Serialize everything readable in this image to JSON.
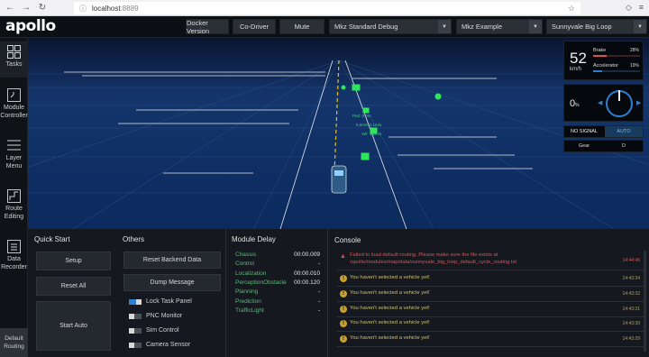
{
  "browser": {
    "url_host": "localhost",
    "url_port": ":8889"
  },
  "app": {
    "logo": "apollo"
  },
  "topbar": {
    "docker_version": "Docker Version",
    "co_driver": "Co-Driver",
    "mute": "Mute",
    "mode_select": "Mkz Standard Debug",
    "vehicle_select": "Mkz Example",
    "map_select": "Sunnyvale Big Loop"
  },
  "sidebar": {
    "items": [
      {
        "label": "Tasks",
        "icon": "tasks-grid-icon"
      },
      {
        "label": "Module Controller",
        "icon": "module-controller-icon"
      },
      {
        "label": "Layer Menu",
        "icon": "layer-menu-icon"
      },
      {
        "label": "Route Editing",
        "icon": "route-editing-icon"
      },
      {
        "label": "Data Recorder",
        "icon": "data-recorder-icon"
      }
    ],
    "default_routing": "Default Routing"
  },
  "status": {
    "speed": "52",
    "speed_unit": "km/h",
    "brake_label": "Brake",
    "brake_value": "28%",
    "accel_label": "Accelerator",
    "accel_value": "19%",
    "brake_fraction": 0.28,
    "accel_fraction": 0.19,
    "steering_value": "0",
    "steering_unit": "%",
    "signal": "NO SIGNAL",
    "drive_mode": "AUTO",
    "gear_label": "Gear",
    "gear_value": "D"
  },
  "scene": {
    "obstacle_labels": [
      "Ped: 0.0m",
      "0.0m/s 4.1m/s",
      "Vel: 1.2m/s"
    ]
  },
  "quick_start": {
    "title": "Quick Start",
    "setup": "Setup",
    "reset_all": "Reset All",
    "start_auto": "Start Auto"
  },
  "others": {
    "title": "Others",
    "reset_backend": "Reset Backend Data",
    "dump_message": "Dump Message",
    "toggles": [
      {
        "label": "Lock Task Panel",
        "on": true
      },
      {
        "label": "PNC Monitor",
        "on": false
      },
      {
        "label": "Sim Control",
        "on": false
      },
      {
        "label": "Camera Sensor",
        "on": false
      }
    ]
  },
  "module_delay": {
    "title": "Module Delay",
    "rows": [
      {
        "name": "Chassis",
        "value": "00:00.009"
      },
      {
        "name": "Control",
        "value": "-"
      },
      {
        "name": "Localization",
        "value": "00:00.010"
      },
      {
        "name": "PerceptionObstacle",
        "value": "00:00.120"
      },
      {
        "name": "Planning",
        "value": "-"
      },
      {
        "name": "Prediction",
        "value": "-"
      },
      {
        "name": "TrafficLight",
        "value": "-"
      }
    ]
  },
  "console": {
    "title": "Console",
    "error": "Failed to load default routing. Please make sure the file exists at /apollo/modules/map/data/sunnyvale_big_loop_default_cycle_routing.txt",
    "error_time": "14:44:46",
    "warnings": [
      {
        "text": "You haven't selected a vehicle yet!",
        "time": "14:43:34"
      },
      {
        "text": "You haven't selected a vehicle yet!",
        "time": "14:43:32"
      },
      {
        "text": "You haven't selected a vehicle yet!",
        "time": "14:43:31"
      },
      {
        "text": "You haven't selected a vehicle yet!",
        "time": "14:43:30"
      },
      {
        "text": "You haven't selected a vehicle yet!",
        "time": "14:43:29"
      }
    ]
  },
  "colors": {
    "accent": "#2e7fd0",
    "delay_green": "#5bb97a",
    "error_red": "#d9534f",
    "warning_yellow": "#d0c070"
  }
}
